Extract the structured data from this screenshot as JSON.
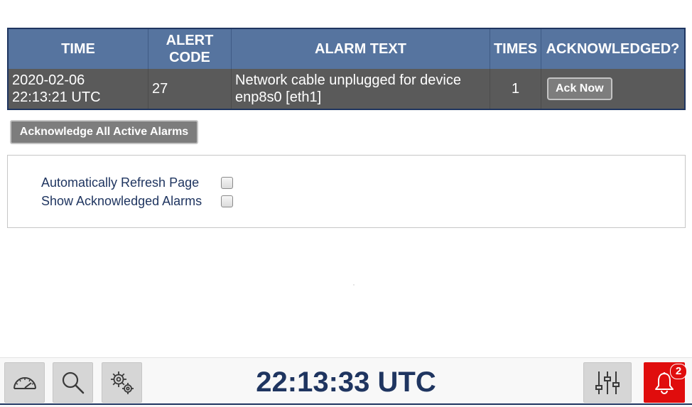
{
  "table": {
    "headers": [
      "TIME",
      "ALERT\nCODE",
      "ALARM TEXT",
      "TIMES",
      "ACKNOWLEDGED?"
    ],
    "rows": [
      {
        "time": "2020-02-06\n22:13:21 UTC",
        "code": "27",
        "text": "Network cable unplugged for device enp8s0 [eth1]",
        "times": "1",
        "ack_label": "Ack Now"
      }
    ]
  },
  "ack_all_label": "Acknowledge All Active Alarms",
  "options": {
    "auto_refresh_label": "Automatically Refresh Page",
    "auto_refresh_checked": false,
    "show_ack_label": "Show Acknowledged Alarms",
    "show_ack_checked": false
  },
  "footer": {
    "clock": "22:13:33 UTC",
    "alarm_count": "2",
    "icons": [
      "dashboard-gauge-icon",
      "search-icon",
      "settings-gears-icon",
      "sliders-icon",
      "bell-icon"
    ]
  },
  "colors": {
    "header_bg": "#56749f",
    "row_bg": "#5a5a5a",
    "navy": "#1f3560",
    "alarm_red": "#e00d0d",
    "button_gray": "#7d7d7d"
  }
}
